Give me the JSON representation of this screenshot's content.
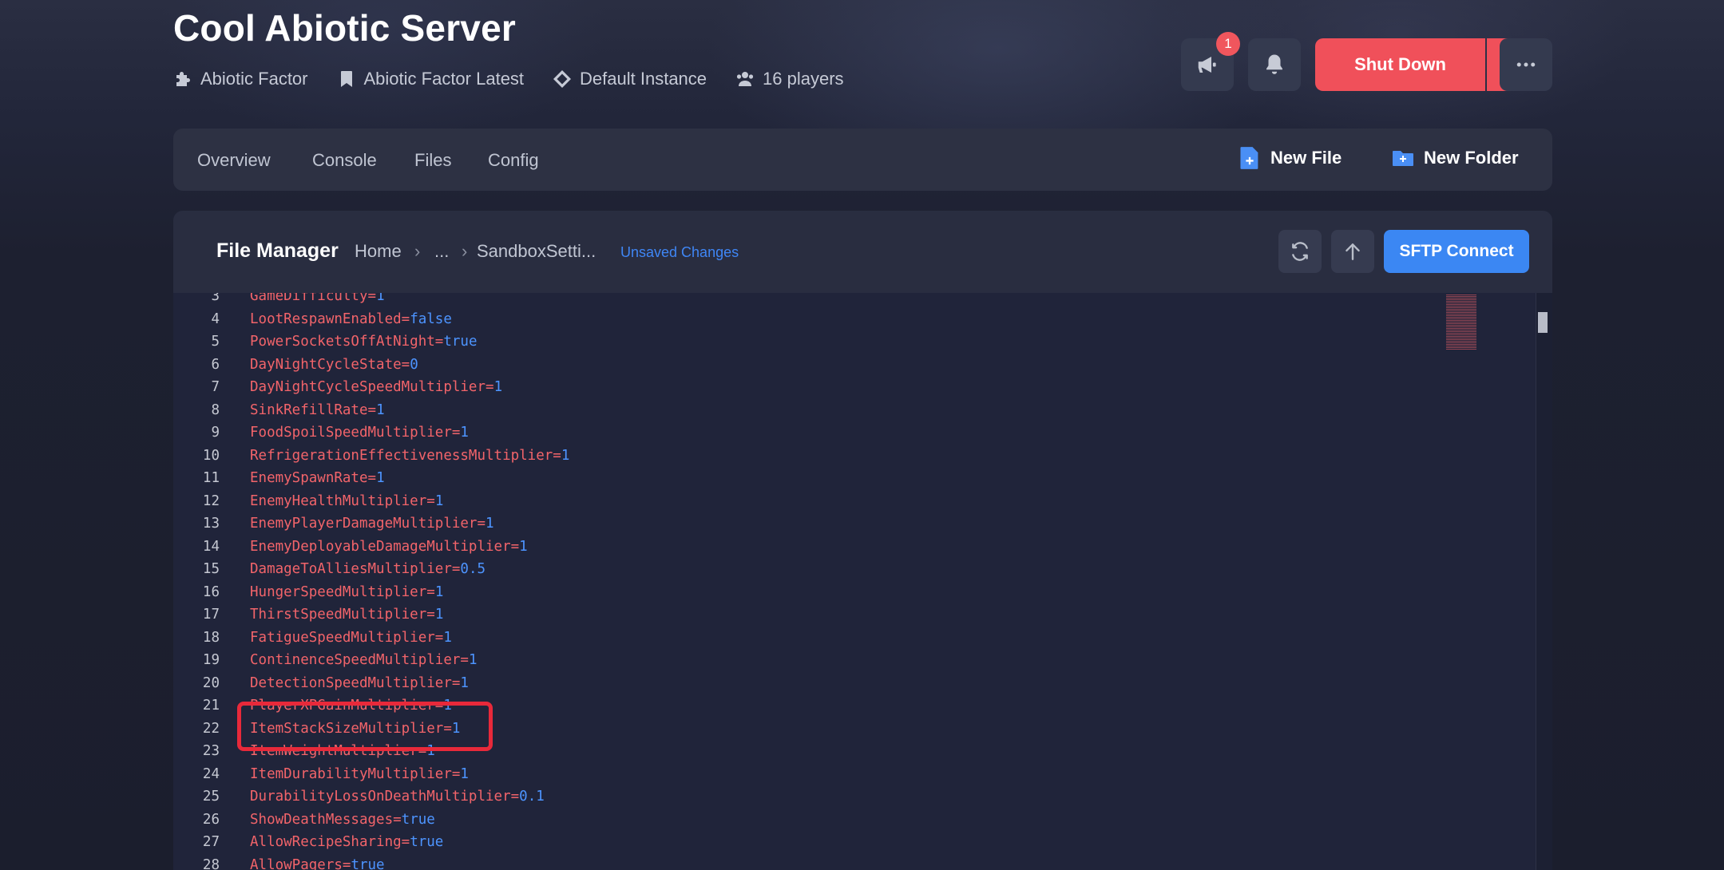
{
  "server": {
    "title": "Cool Abiotic Server",
    "meta": [
      {
        "icon": "puzzle-icon",
        "label": "Abiotic Factor"
      },
      {
        "icon": "bookmark-icon",
        "label": "Abiotic Factor Latest"
      },
      {
        "icon": "diamond-icon",
        "label": "Default Instance"
      },
      {
        "icon": "users-icon",
        "label": "16 players"
      }
    ]
  },
  "header_actions": {
    "announcements_badge": "1",
    "shutdown_label": "Shut Down",
    "colors": {
      "danger": "#f0505a",
      "primary": "#3b87f3"
    }
  },
  "nav": {
    "tabs": [
      "Overview",
      "Console",
      "Files",
      "Config"
    ],
    "new_file_label": "New File",
    "new_folder_label": "New Folder"
  },
  "file_manager": {
    "title": "File Manager",
    "breadcrumb": [
      "Home",
      "...",
      "SandboxSetti..."
    ],
    "unsaved_label": "Unsaved Changes",
    "sftp_label": "SFTP Connect"
  },
  "editor": {
    "highlighted_line": 22,
    "lines": [
      {
        "n": "3",
        "key": "GameDifficulty",
        "val": "1"
      },
      {
        "n": "4",
        "key": "LootRespawnEnabled",
        "val": "false"
      },
      {
        "n": "5",
        "key": "PowerSocketsOffAtNight",
        "val": "true"
      },
      {
        "n": "6",
        "key": "DayNightCycleState",
        "val": "0"
      },
      {
        "n": "7",
        "key": "DayNightCycleSpeedMultiplier",
        "val": "1"
      },
      {
        "n": "8",
        "key": "SinkRefillRate",
        "val": "1"
      },
      {
        "n": "9",
        "key": "FoodSpoilSpeedMultiplier",
        "val": "1"
      },
      {
        "n": "10",
        "key": "RefrigerationEffectivenessMultiplier",
        "val": "1"
      },
      {
        "n": "11",
        "key": "EnemySpawnRate",
        "val": "1"
      },
      {
        "n": "12",
        "key": "EnemyHealthMultiplier",
        "val": "1"
      },
      {
        "n": "13",
        "key": "EnemyPlayerDamageMultiplier",
        "val": "1"
      },
      {
        "n": "14",
        "key": "EnemyDeployableDamageMultiplier",
        "val": "1"
      },
      {
        "n": "15",
        "key": "DamageToAlliesMultiplier",
        "val": "0.5"
      },
      {
        "n": "16",
        "key": "HungerSpeedMultiplier",
        "val": "1"
      },
      {
        "n": "17",
        "key": "ThirstSpeedMultiplier",
        "val": "1"
      },
      {
        "n": "18",
        "key": "FatigueSpeedMultiplier",
        "val": "1"
      },
      {
        "n": "19",
        "key": "ContinenceSpeedMultiplier",
        "val": "1"
      },
      {
        "n": "20",
        "key": "DetectionSpeedMultiplier",
        "val": "1"
      },
      {
        "n": "21",
        "key": "PlayerXPGainMultiplier",
        "val": "1"
      },
      {
        "n": "22",
        "key": "ItemStackSizeMultiplier",
        "val": "1"
      },
      {
        "n": "23",
        "key": "ItemWeightMultiplier",
        "val": "1"
      },
      {
        "n": "24",
        "key": "ItemDurabilityMultiplier",
        "val": "1"
      },
      {
        "n": "25",
        "key": "DurabilityLossOnDeathMultiplier",
        "val": "0.1"
      },
      {
        "n": "26",
        "key": "ShowDeathMessages",
        "val": "true"
      },
      {
        "n": "27",
        "key": "AllowRecipeSharing",
        "val": "true"
      },
      {
        "n": "28",
        "key": "AllowPagers",
        "val": "true"
      }
    ]
  }
}
